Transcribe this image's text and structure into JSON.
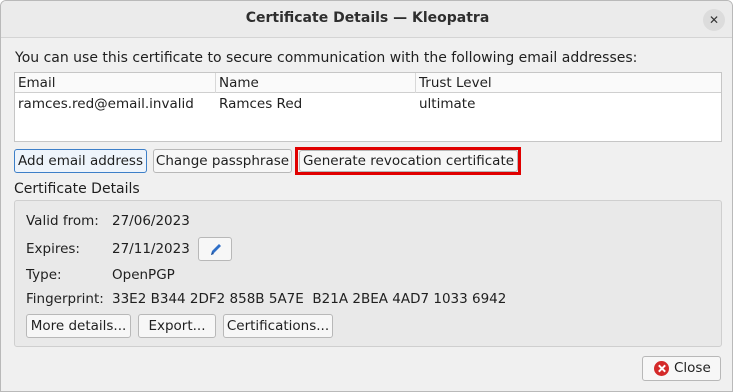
{
  "window": {
    "title": "Certificate Details — Kleopatra",
    "close_glyph": "✕"
  },
  "intro_text": "You can use this certificate to secure communication with the following email addresses:",
  "table": {
    "columns": [
      "Email",
      "Name",
      "Trust Level"
    ],
    "rows": [
      {
        "email": "ramces.red@email.invalid",
        "name": "Ramces Red",
        "trust": "ultimate"
      }
    ]
  },
  "buttons": {
    "add_email": "Add email address",
    "change_pass": "Change passphrase",
    "gen_revocation": "Generate revocation certificate",
    "more_details": "More details...",
    "export": "Export...",
    "certifications": "Certifications...",
    "close": "Close"
  },
  "details": {
    "section_title": "Certificate Details",
    "valid_from_label": "Valid from:",
    "valid_from": "27/06/2023",
    "expires_label": "Expires:",
    "expires": "27/11/2023",
    "type_label": "Type:",
    "type": "OpenPGP",
    "fingerprint_label": "Fingerprint:",
    "fingerprint": "33E2 B344 2DF2 858B 5A7E  B21A 2BEA 4AD7 1033 6942"
  },
  "colors": {
    "highlight": "#e00000",
    "close_icon": "#d42a2a",
    "edit_icon": "#2f6fc7"
  },
  "icons": {
    "edit": "pencil-icon",
    "close_dialog": "close-icon",
    "close_button": "cancel-icon"
  }
}
